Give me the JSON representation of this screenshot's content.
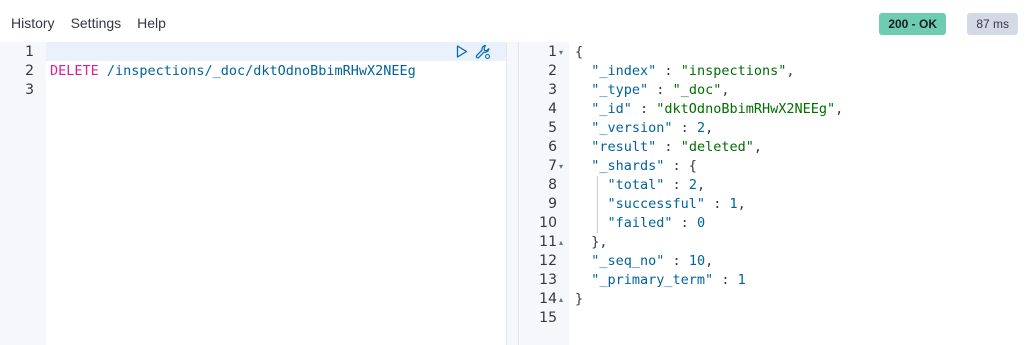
{
  "menu": {
    "history": "History",
    "settings": "Settings",
    "help": "Help"
  },
  "status": {
    "code": "200 - OK",
    "time": "87 ms",
    "ok_color": "#6dccb1"
  },
  "request": {
    "line_numbers": [
      "1",
      "2",
      "3"
    ],
    "method": "DELETE",
    "path": " /inspections/_doc/dktOdnoBbimRHwX2NEEg",
    "icons": [
      "play-icon",
      "wrench-icon"
    ]
  },
  "response": {
    "line_numbers": [
      "1",
      "2",
      "3",
      "4",
      "5",
      "6",
      "7",
      "8",
      "9",
      "10",
      "11",
      "12",
      "13",
      "14",
      "15"
    ],
    "open_brace": "{",
    "index_key": "\"_index\"",
    "index_val": "\"inspections\"",
    "type_key": "\"_type\"",
    "type_val": "\"_doc\"",
    "id_key": "\"_id\"",
    "id_val": "\"dktOdnoBbimRHwX2NEEg\"",
    "version_key": "\"_version\"",
    "version_val": "2",
    "result_key": "\"result\"",
    "result_val": "\"deleted\"",
    "shards_key": "\"_shards\"",
    "total_key": "\"total\"",
    "total_val": "2",
    "successful_key": "\"successful\"",
    "successful_val": "1",
    "failed_key": "\"failed\"",
    "failed_val": "0",
    "shards_close": "},",
    "seq_no_key": "\"_seq_no\"",
    "seq_no_val": "10",
    "primary_term_key": "\"_primary_term\"",
    "primary_term_val": "1",
    "close_brace": "}"
  }
}
